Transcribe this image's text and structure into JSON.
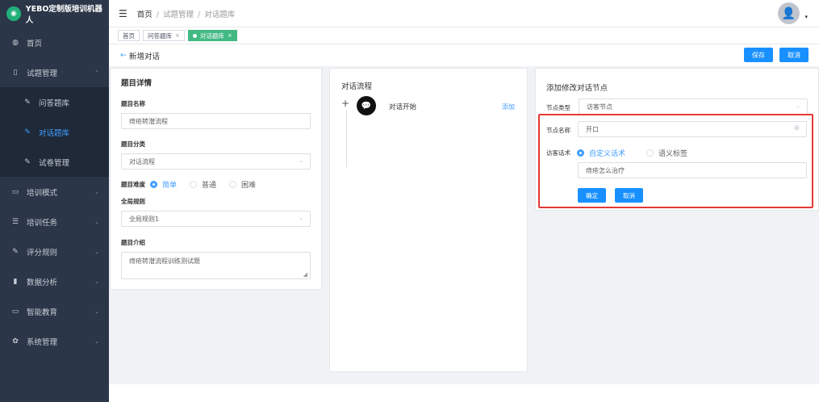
{
  "app": {
    "title": "YEBO定制版培训机器人",
    "logo_glyph": "◉"
  },
  "sidebar": {
    "items": [
      {
        "label": "首页",
        "icon": "dashboard-icon",
        "glyph": "◍",
        "type": "top",
        "active": false,
        "arrow": ""
      },
      {
        "label": "试题管理",
        "icon": "book-icon",
        "glyph": "▯",
        "type": "top",
        "active": false,
        "arrow": "⌃"
      },
      {
        "label": "问答题库",
        "icon": "edit-icon",
        "glyph": "✎",
        "type": "sub",
        "active": false,
        "arrow": ""
      },
      {
        "label": "对话题库",
        "icon": "edit-icon",
        "glyph": "✎",
        "type": "sub",
        "active": true,
        "arrow": ""
      },
      {
        "label": "试卷管理",
        "icon": "edit-icon",
        "glyph": "✎",
        "type": "sub",
        "active": false,
        "arrow": ""
      },
      {
        "label": "培训模式",
        "icon": "monitor-icon",
        "glyph": "▭",
        "type": "top",
        "active": false,
        "arrow": "⌄"
      },
      {
        "label": "培训任务",
        "icon": "list-icon",
        "glyph": "☰",
        "type": "top",
        "active": false,
        "arrow": "⌄"
      },
      {
        "label": "评分规则",
        "icon": "edit-icon",
        "glyph": "✎",
        "type": "top",
        "active": false,
        "arrow": "⌄"
      },
      {
        "label": "数据分析",
        "icon": "bar-chart-icon",
        "glyph": "▮",
        "type": "top",
        "active": false,
        "arrow": "⌄"
      },
      {
        "label": "智能教育",
        "icon": "screen-icon",
        "glyph": "▭",
        "type": "top",
        "active": false,
        "arrow": "⌄"
      },
      {
        "label": "系统管理",
        "icon": "gear-icon",
        "glyph": "✿",
        "type": "top",
        "active": false,
        "arrow": "⌄"
      }
    ]
  },
  "header": {
    "menu_glyph": "☰",
    "breadcrumb": [
      "首页",
      "试题管理",
      "对话题库"
    ],
    "separator": "/",
    "avatar_glyph": "👤",
    "caret": "▾"
  },
  "tags": [
    {
      "label": "首页",
      "closable": false,
      "active": false
    },
    {
      "label": "问答题库",
      "closable": true,
      "active": false
    },
    {
      "label": "对话题库",
      "closable": true,
      "active": true
    }
  ],
  "tag_close": "×",
  "page": {
    "back_glyph": "←",
    "title": "新增对话",
    "save_label": "保存",
    "cancel_label": "取消"
  },
  "details": {
    "title": "题目详情",
    "name_label": "题目名称",
    "name_value": "痔疮转潜流程",
    "category_label": "题目分类",
    "category_value": "对话流程",
    "difficulty_label": "题目难度",
    "difficulty_options": [
      "简单",
      "普通",
      "困难"
    ],
    "difficulty_selected": 0,
    "rule_label": "全局规则",
    "rule_value": "全局规则1",
    "intro_label": "题目介绍",
    "intro_value": "痔疮转潜流程训练测试题"
  },
  "flow": {
    "title": "对话流程",
    "plus": "+",
    "node_label": "对话开始",
    "node_glyph": "💬",
    "add_label": "添加"
  },
  "node_form": {
    "title": "添加修改对话节点",
    "type_label": "节点类型",
    "type_value": "访客节点",
    "name_label": "节点名称",
    "name_value": "开口",
    "clear_glyph": "⊗",
    "speech_label": "访客话术",
    "speech_options": [
      "自定义话术",
      "语义标签"
    ],
    "speech_selected": 0,
    "speech_value": "痔疮怎么治疗",
    "confirm_label": "确定",
    "cancel_label": "取消"
  },
  "chev_down": "⌄",
  "resize_grip": "◢",
  "colors": {
    "primary": "#1890ff",
    "highlight_border": "#e53935",
    "tag_active": "#42b983",
    "sidebar_bg": "#2b3648"
  }
}
